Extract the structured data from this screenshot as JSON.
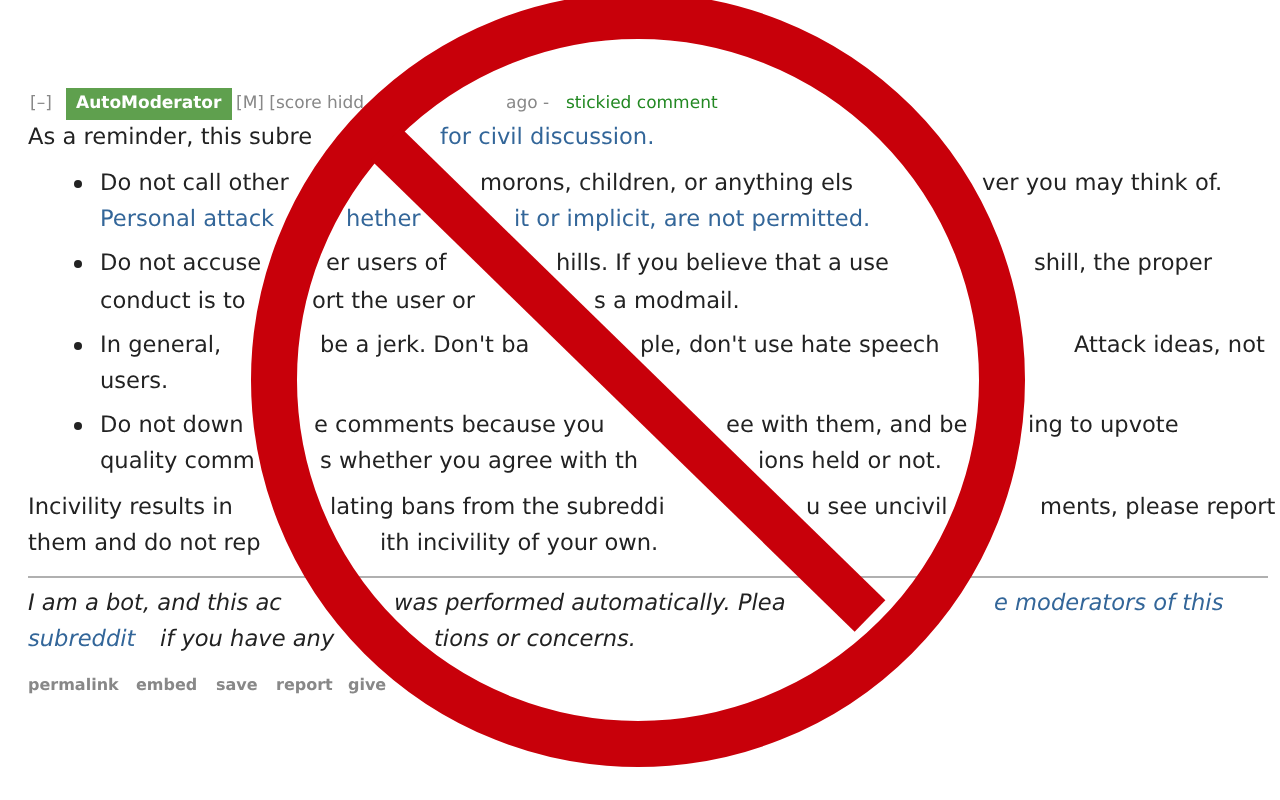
{
  "comment": {
    "collapse_toggle": "[–]",
    "author": "AutoModerator",
    "meta": "[M] [score hidd",
    "time": "ago -",
    "stickied": "stickied comment",
    "lines": [
      {
        "kind": "body",
        "fragments": [
          {
            "kind": "text",
            "text": "As a reminder, this subre"
          },
          {
            "kind": "link",
            "text": "for civil discussion."
          }
        ]
      },
      {
        "kind": "bullet",
        "fragments": [
          {
            "kind": "text",
            "text": "Do not call other"
          },
          {
            "kind": "text",
            "text": "morons, children, or anything els"
          },
          {
            "kind": "text",
            "text": "ver you may think of."
          }
        ]
      },
      {
        "kind": "continued",
        "fragments": [
          {
            "kind": "link",
            "text": "Personal attack"
          },
          {
            "kind": "link",
            "text": "hether"
          },
          {
            "kind": "link",
            "text": "it or implicit, are not permitted."
          }
        ]
      },
      {
        "kind": "bullet",
        "fragments": [
          {
            "kind": "text",
            "text": "Do not accuse"
          },
          {
            "kind": "text",
            "text": "er users of"
          },
          {
            "kind": "text",
            "text": "hills. If you believe that a use"
          },
          {
            "kind": "text",
            "text": "shill, the proper"
          }
        ]
      },
      {
        "kind": "continued",
        "fragments": [
          {
            "kind": "text",
            "text": "conduct is to"
          },
          {
            "kind": "text",
            "text": "ort the user or"
          },
          {
            "kind": "text",
            "text": "s a modmail."
          }
        ]
      },
      {
        "kind": "bullet",
        "fragments": [
          {
            "kind": "text",
            "text": "In general,"
          },
          {
            "kind": "text",
            "text": "be a jerk. Don't ba"
          },
          {
            "kind": "text",
            "text": "ple, don't use hate speech"
          },
          {
            "kind": "text",
            "text": "Attack ideas, not"
          }
        ]
      },
      {
        "kind": "continued",
        "fragments": [
          {
            "kind": "text",
            "text": "users."
          }
        ]
      },
      {
        "kind": "bullet",
        "fragments": [
          {
            "kind": "text",
            "text": "Do not down"
          },
          {
            "kind": "text",
            "text": "e comments because you"
          },
          {
            "kind": "text",
            "text": "ee with them, and be"
          },
          {
            "kind": "text",
            "text": "ing to upvote"
          }
        ]
      },
      {
        "kind": "continued",
        "fragments": [
          {
            "kind": "text",
            "text": "quality comm"
          },
          {
            "kind": "text",
            "text": "s whether you agree with th"
          },
          {
            "kind": "text",
            "text": "ions held or not."
          }
        ]
      },
      {
        "kind": "body",
        "fragments": [
          {
            "kind": "text",
            "text": "Incivility results in"
          },
          {
            "kind": "text",
            "text": "lating bans from the subreddi"
          },
          {
            "kind": "text",
            "text": "u see uncivil"
          },
          {
            "kind": "text",
            "text": "ments, please report"
          }
        ]
      },
      {
        "kind": "body",
        "fragments": [
          {
            "kind": "text",
            "text": "them and do not rep"
          },
          {
            "kind": "text",
            "text": "ith incivility of your own."
          }
        ]
      },
      {
        "kind": "note",
        "fragments": [
          {
            "kind": "text",
            "text": "I am a bot, and this ac"
          },
          {
            "kind": "text",
            "text": "was performed automatically. Plea"
          },
          {
            "kind": "link",
            "text": "e moderators of this"
          }
        ]
      },
      {
        "kind": "note",
        "fragments": [
          {
            "kind": "link",
            "text": "subreddit"
          },
          {
            "kind": "text",
            "text": "if you have any"
          },
          {
            "kind": "text",
            "text": "tions or concerns."
          }
        ]
      }
    ],
    "actions": [
      "permalink",
      "embed",
      "save",
      "report",
      "give"
    ]
  }
}
